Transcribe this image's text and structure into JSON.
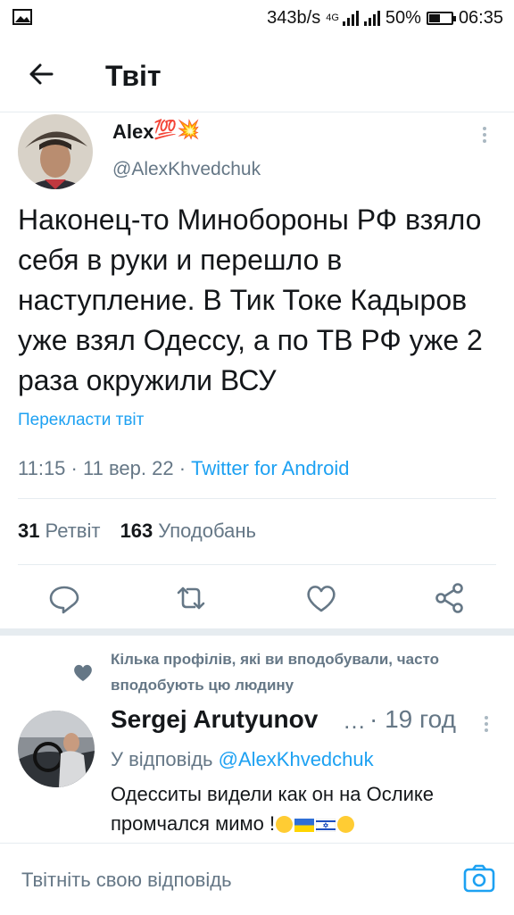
{
  "status_bar": {
    "speed": "343b/s",
    "network": "4G",
    "battery": "50%",
    "battery_level": 0.5,
    "time": "06:35"
  },
  "header": {
    "title": "Твіт"
  },
  "tweet": {
    "display_name": "Alex",
    "name_emoji": "💯💥",
    "handle": "@AlexKhvedchuk",
    "text": "Наконец-то Минобороны РФ взяло себя в руки и перешло в наступление. В Тик Токе Кадыров уже взял Одессу, а по ТВ РФ уже 2 раза окружили ВСУ",
    "translate_label": "Перекласти твіт",
    "time": "11:15",
    "date": "11 вер. 22",
    "source": "Twitter for Android",
    "retweets": "31",
    "retweets_label": "Ретвіт",
    "likes": "163",
    "likes_label": "Уподобань"
  },
  "social_context": "Кілька профілів, які ви вподобували, часто вподобують цю людину",
  "reply": {
    "display_name": "Sergej Arutyunov",
    "ellipsis": "…",
    "time": "19 год",
    "replying_prefix": "У відповідь",
    "replying_handle": "@AlexKhvedchuk",
    "text": "Одесситы видели как он на Ослике промчался мимо !"
  },
  "composer": {
    "placeholder": "Твітніть свою відповідь"
  },
  "colors": {
    "accent": "#1da1f2",
    "secondary_text": "#657786",
    "divider": "#e6ecf0"
  }
}
